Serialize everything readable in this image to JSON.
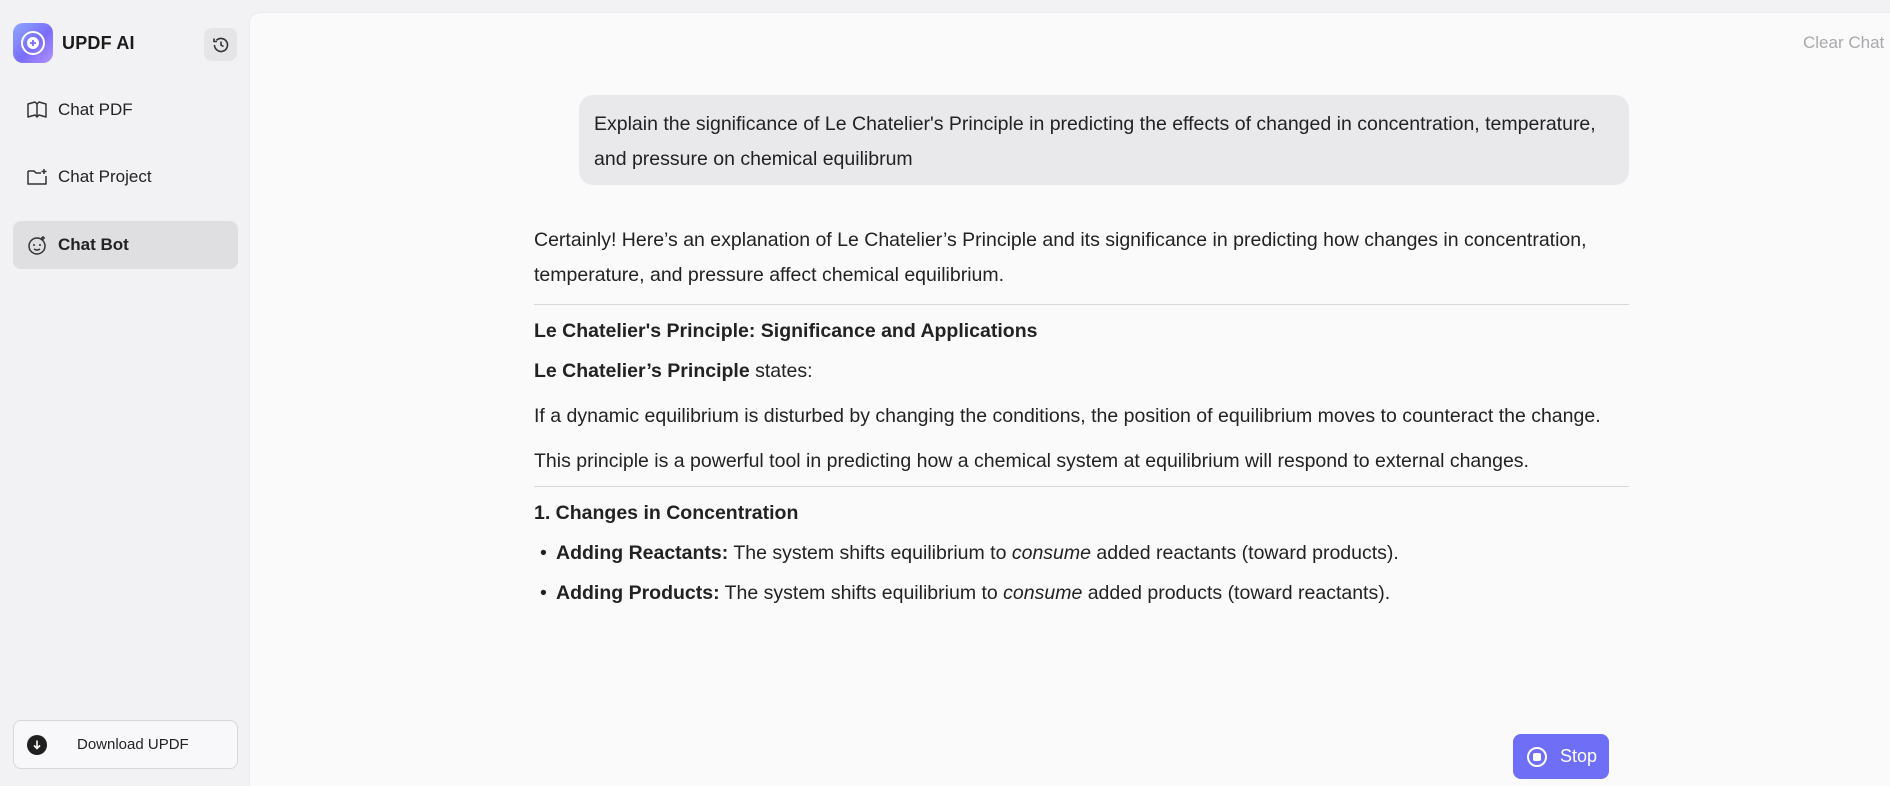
{
  "sidebar": {
    "brand": "UPDF AI",
    "nav": [
      {
        "label": "Chat PDF",
        "icon": "book-chat-icon"
      },
      {
        "label": "Chat Project",
        "icon": "folder-chat-icon"
      },
      {
        "label": "Chat Bot",
        "icon": "bot-icon"
      }
    ],
    "active": "Chat Bot",
    "download_label": "Download UPDF"
  },
  "header": {
    "clear_chat": "Clear Chat"
  },
  "chat": {
    "user_message": "Explain the significance of Le Chatelier's Principle in predicting the effects of changed in concentration, temperature, and pressure on chemical equilibrum",
    "answer": {
      "intro": "Certainly! Here’s an explanation of Le Chatelier’s Principle and its significance in predicting how changes in concentration, temperature, and pressure affect chemical equilibrium.",
      "heading": "Le Chatelier's Principle: Significance and Applications",
      "principle_bold": "Le Chatelier’s Principle",
      "principle_rest": " states:",
      "definition": "If a dynamic equilibrium is disturbed by changing the conditions, the position of equilibrium moves to counteract the change.",
      "tool_text": "This principle is a powerful tool in predicting how a chemical system at equilibrium will respond to external changes.",
      "section1_heading": "1. Changes in Concentration",
      "bullets": [
        {
          "bold": "Adding Reactants:",
          "pre": " The system shifts equilibrium to ",
          "italic": "consume",
          "post": " added reactants (toward products)."
        },
        {
          "bold": "Adding Products:",
          "pre": " The system shifts equilibrium to ",
          "italic": "consume",
          "post": " added products (toward reactants)."
        }
      ]
    }
  },
  "stop_label": "Stop",
  "colors": {
    "accent": "#6f6ef6",
    "sidebar_bg": "#f2f2f4",
    "bubble_bg": "#e9e9ec"
  }
}
